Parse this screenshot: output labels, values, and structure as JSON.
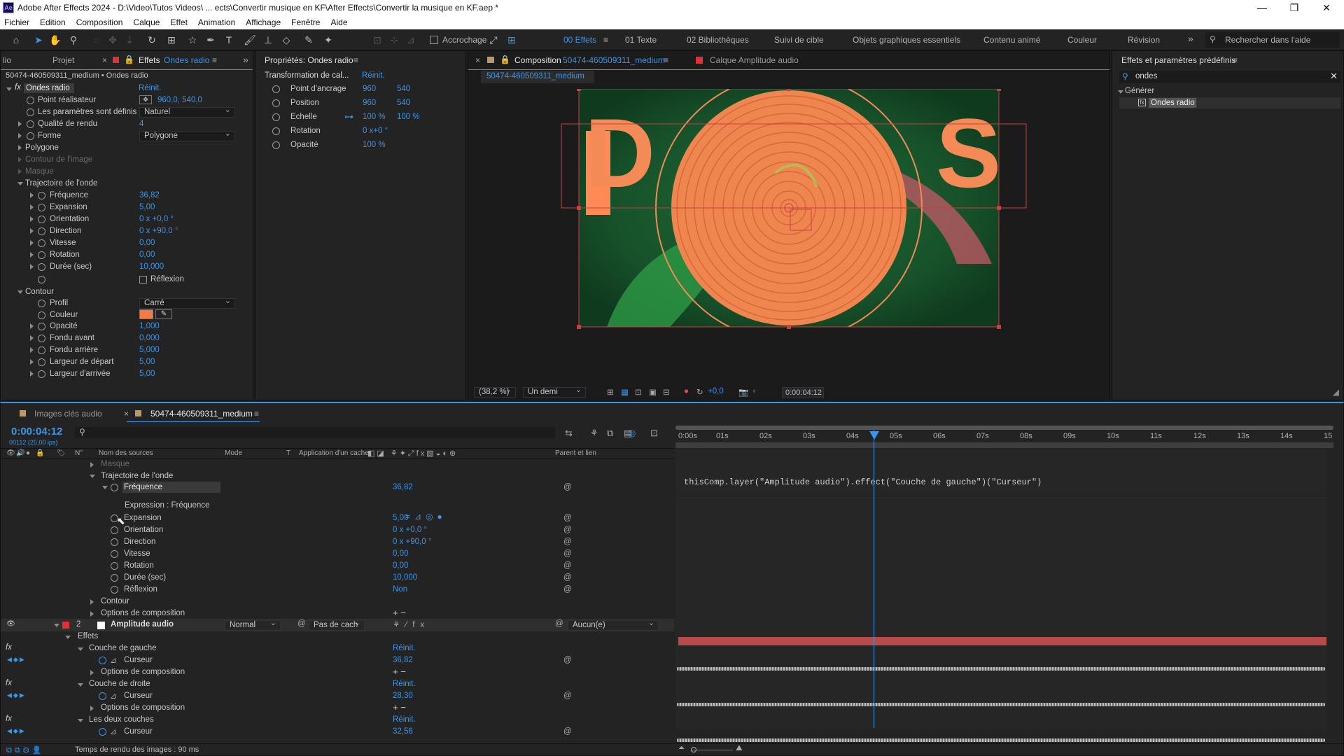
{
  "window": {
    "title": "Adobe After Effects 2024 - D:\\Video\\Tutos Videos\\ ... ects\\Convertir musique en KF\\After Effects\\Convertir la musique en KF.aep *",
    "app_badge": "Ae"
  },
  "menu": [
    "Fichier",
    "Edition",
    "Composition",
    "Calque",
    "Effet",
    "Animation",
    "Affichage",
    "Fenêtre",
    "Aide"
  ],
  "toolbar": {
    "snap_label": "Accrochage",
    "workspaces": [
      "00 Effets",
      "01 Texte",
      "02 Bibliothèques",
      "Suivi de cible",
      "Objets graphiques essentiels",
      "Contenu animé",
      "Couleur",
      "Révision"
    ],
    "more": "»",
    "search_placeholder": "Rechercher dans l'aide"
  },
  "effects_panel": {
    "tabs": [
      "lio",
      "Projet",
      "Effets",
      "Ondes radio"
    ],
    "menu_icon": "≡",
    "collapse": "»",
    "header": "50474-460509311_medium • Ondes radio",
    "effect_name": "Ondes radio",
    "reset": "Réinit.",
    "rows": [
      {
        "label": "Point réalisateur",
        "value": "960,0, 540,0"
      },
      {
        "label": "Les paramètres sont définis",
        "value": "Naturel"
      },
      {
        "label": "Qualité de rendu",
        "value": "4"
      },
      {
        "label": "Forme",
        "value": "Polygone"
      },
      {
        "label": "Polygone",
        "value": ""
      },
      {
        "label": "Contour de l'image",
        "value": ""
      },
      {
        "label": "Masque",
        "value": ""
      },
      {
        "label": "Trajectoire de l'onde",
        "value": ""
      },
      {
        "label": "Fréquence",
        "value": "36,82"
      },
      {
        "label": "Expansion",
        "value": "5,00"
      },
      {
        "label": "Orientation",
        "value": "0 x +0,0 °"
      },
      {
        "label": "Direction",
        "value": "0 x +90,0 °"
      },
      {
        "label": "Vitesse",
        "value": "0,00"
      },
      {
        "label": "Rotation",
        "value": "0,00"
      },
      {
        "label": "Durée (sec)",
        "value": "10,000"
      },
      {
        "label": "",
        "value": "Réflexion"
      },
      {
        "label": "Contour",
        "value": ""
      },
      {
        "label": "Profil",
        "value": "Carré"
      },
      {
        "label": "Couleur",
        "value": ""
      },
      {
        "label": "Opacité",
        "value": "1,000"
      },
      {
        "label": "Fondu avant",
        "value": "0,000"
      },
      {
        "label": "Fondu arrière",
        "value": "5,000"
      },
      {
        "label": "Largeur de départ",
        "value": "5,00"
      },
      {
        "label": "Largeur d'arrivée",
        "value": "5,00"
      }
    ]
  },
  "properties_panel": {
    "title": "Propriétés: Ondes radio",
    "section": "Transformation de cal...",
    "reset": "Réinit.",
    "rows": [
      {
        "label": "Point d'ancrage",
        "v1": "960",
        "v2": "540"
      },
      {
        "label": "Position",
        "v1": "960",
        "v2": "540"
      },
      {
        "label": "Echelle",
        "v1": "100 %",
        "v2": "100 %"
      },
      {
        "label": "Rotation",
        "v1": "0 x+0 °",
        "v2": ""
      },
      {
        "label": "Opacité",
        "v1": "100 %",
        "v2": ""
      }
    ]
  },
  "composition_panel": {
    "tab_label": "Composition",
    "comp_name": "50474-460509311_medium",
    "layer_tab": "Calque Amplitude audio",
    "crumb": "50474-460509311_medium",
    "zoom": "(38,2 %)",
    "resolution": "Un demi",
    "exposure": "+0,0",
    "timecode": "0:00:04:12",
    "artwork_letters": "DJS"
  },
  "presets_panel": {
    "title": "Effets et paramètres prédéfinis",
    "search_value": "ondes",
    "category": "Générer",
    "item": "Ondes radio"
  },
  "timeline": {
    "tabs": [
      "Images clés audio",
      "50474-460509311_medium"
    ],
    "timecode": "0:00:04:12",
    "frame_info": "00112 (25,00 ips)",
    "columns": {
      "num": "N°",
      "source": "Nom des sources",
      "mode": "Mode",
      "t": "T",
      "cache": "Application d'un cache",
      "parent": "Parent et lien"
    },
    "rows": [
      {
        "indent": 4,
        "label": "Masque",
        "value": "",
        "grey": true
      },
      {
        "indent": 4,
        "label": "Trajectoire de l'onde",
        "value": ""
      },
      {
        "indent": 5,
        "label": "Fréquence",
        "value": "36,82",
        "red": true
      },
      {
        "indent": 6,
        "label": "Expression : Fréquence",
        "value": ""
      },
      {
        "indent": 5,
        "label": "Expansion",
        "value": "5,00"
      },
      {
        "indent": 5,
        "label": "Orientation",
        "value": "0 x +0,0 °"
      },
      {
        "indent": 5,
        "label": "Direction",
        "value": "0 x +90,0 °"
      },
      {
        "indent": 5,
        "label": "Vitesse",
        "value": "0,00"
      },
      {
        "indent": 5,
        "label": "Rotation",
        "value": "0,00"
      },
      {
        "indent": 5,
        "label": "Durée (sec)",
        "value": "10,000"
      },
      {
        "indent": 5,
        "label": "Réflexion",
        "value": "Non"
      },
      {
        "indent": 4,
        "label": "Contour",
        "value": ""
      },
      {
        "indent": 4,
        "label": "Options de composition",
        "value": ""
      }
    ],
    "layer2": {
      "num": "2",
      "name": "Amplitude audio",
      "mode": "Normal",
      "matte": "Pas de cach",
      "parent": "Aucun(e)"
    },
    "layer2_rows": [
      {
        "label": "Effets",
        "value": ""
      },
      {
        "label": "Couche de gauche",
        "value": "Réinit."
      },
      {
        "label": "Curseur",
        "value": "36,82"
      },
      {
        "label": "Options de composition",
        "value": ""
      },
      {
        "label": "Couche de droite",
        "value": "Réinit."
      },
      {
        "label": "Curseur",
        "value": "28,30"
      },
      {
        "label": "Options de composition",
        "value": ""
      },
      {
        "label": "Les deux couches",
        "value": "Réinit."
      },
      {
        "label": "Curseur",
        "value": "32,56"
      }
    ],
    "expression": "thisComp.layer(\"Amplitude audio\").effect(\"Couche de gauche\")(\"Curseur\")",
    "ruler": [
      "0:00s",
      "01s",
      "02s",
      "03s",
      "04s",
      "05s",
      "06s",
      "07s",
      "08s",
      "09s",
      "10s",
      "11s",
      "12s",
      "13s",
      "14s",
      "15"
    ],
    "render_time": "Temps de rendu des images : 90 ms"
  }
}
